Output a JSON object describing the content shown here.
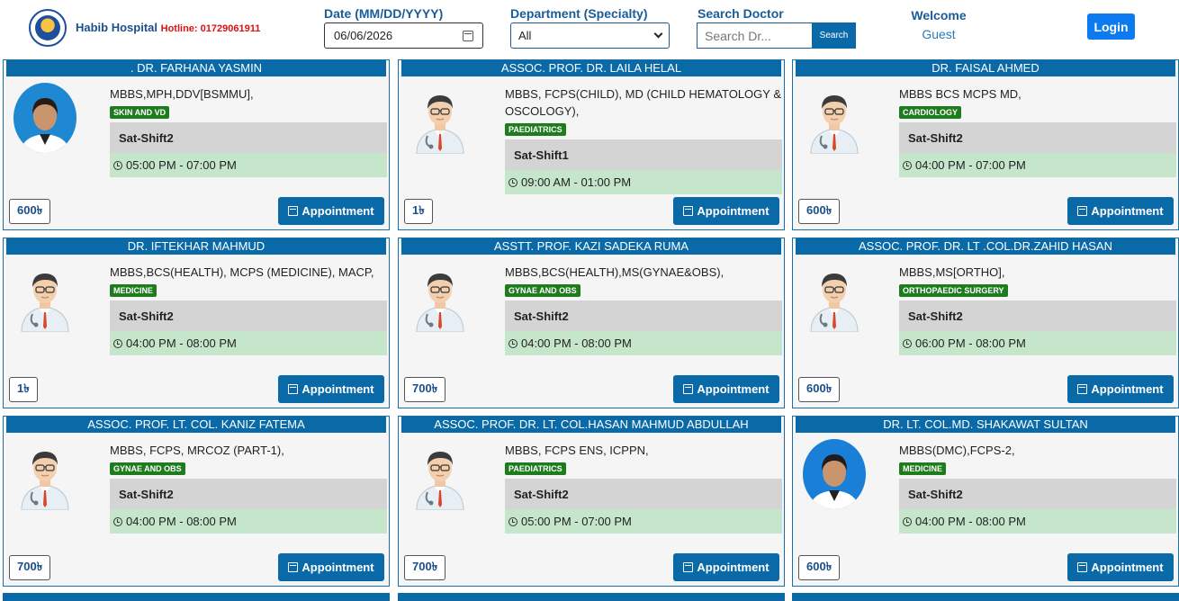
{
  "header": {
    "brand": "Habib Hospital",
    "hotline": "Hotline: 01729061911",
    "date_label": "Date (MM/DD/YYYY)",
    "date_value": "06/06/2026",
    "department_label": "Department (Specialty)",
    "department_value": "All",
    "search_label": "Search Doctor",
    "search_placeholder": "Search Dr...",
    "search_button": "Search",
    "welcome": "Welcome",
    "user": "Guest",
    "login": "Login"
  },
  "appointment_label": "Appointment",
  "doctors": [
    {
      "name": ". DR. FARHANA YASMIN",
      "degree": "MBBS,MPH,DDV[BSMMU],",
      "dept": "SKIN AND VD",
      "shift": "Sat-Shift2",
      "time": "05:00 PM - 07:00 PM",
      "fee": "600৳",
      "avatar": "photo-female"
    },
    {
      "name": "ASSOC. PROF. DR. LAILA HELAL",
      "degree": "MBBS, FCPS(CHILD), MD (CHILD HEMATOLOGY & OSCOLOGY),",
      "dept": "PAEDIATRICS",
      "shift": "Sat-Shift1",
      "time": "09:00 AM - 01:00 PM",
      "fee": "1৳",
      "avatar": "doctor-illustration"
    },
    {
      "name": "DR. FAISAL AHMED",
      "degree": "MBBS BCS MCPS MD,",
      "dept": "CARDIOLOGY",
      "shift": "Sat-Shift2",
      "time": "04:00 PM - 07:00 PM",
      "fee": "600৳",
      "avatar": "doctor-illustration"
    },
    {
      "name": "DR. IFTEKHAR MAHMUD",
      "degree": "MBBS,BCS(HEALTH), MCPS (MEDICINE), MACP,",
      "dept": "MEDICINE",
      "shift": "Sat-Shift2",
      "time": "04:00 PM - 08:00 PM",
      "fee": "1৳",
      "avatar": "doctor-illustration"
    },
    {
      "name": "ASSTT. PROF. KAZI SADEKA RUMA",
      "degree": "MBBS,BCS(HEALTH),MS(GYNAE&OBS),",
      "dept": "GYNAE AND OBS",
      "shift": "Sat-Shift2",
      "time": "04:00 PM - 08:00 PM",
      "fee": "700৳",
      "avatar": "doctor-illustration"
    },
    {
      "name": "ASSOC. PROF. DR. LT .COL.DR.ZAHID HASAN",
      "degree": "MBBS,MS[ORTHO],",
      "dept": "ORTHOPAEDIC SURGERY",
      "shift": "Sat-Shift2",
      "time": "06:00 PM - 08:00 PM",
      "fee": "600৳",
      "avatar": "doctor-illustration"
    },
    {
      "name": "ASSOC. PROF. LT. COL. KANIZ FATEMA",
      "degree": "MBBS, FCPS, MRCOZ (PART-1),",
      "dept": "GYNAE AND OBS",
      "shift": "Sat-Shift2",
      "time": "04:00 PM - 08:00 PM",
      "fee": "700৳",
      "avatar": "doctor-illustration"
    },
    {
      "name": "ASSOC. PROF. DR. LT. COL.HASAN MAHMUD ABDULLAH",
      "degree": "MBBS, FCPS ENS, ICPPN,",
      "dept": "PAEDIATRICS",
      "shift": "Sat-Shift2",
      "time": "05:00 PM - 07:00 PM",
      "fee": "700৳",
      "avatar": "doctor-illustration"
    },
    {
      "name": "DR. LT. COL.MD. SHAKAWAT SULTAN",
      "degree": "MBBS(DMC),FCPS-2,",
      "dept": "MEDICINE",
      "shift": "Sat-Shift2",
      "time": "04:00 PM - 08:00 PM",
      "fee": "600৳",
      "avatar": "photo-male"
    }
  ],
  "colors": {
    "primary": "#0a6aa8",
    "dept_badge": "#1e7b1e",
    "shift_bg": "#d4d4d4",
    "time_bg": "#c5e6cb",
    "login": "#0d7bf0"
  }
}
